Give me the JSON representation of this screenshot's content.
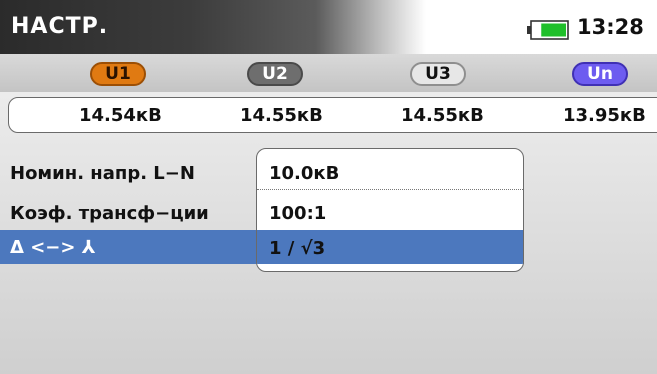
{
  "header": {
    "title": "НАСТР.",
    "time": "13:28",
    "battery_level": 0.75
  },
  "channels": [
    {
      "label": "U1",
      "color": "#e07a12"
    },
    {
      "label": "U2",
      "color": "#6e6e6e"
    },
    {
      "label": "U3",
      "color": "#e7e7e7"
    },
    {
      "label": "Un",
      "color": "#6d5cf0"
    }
  ],
  "readings": [
    "14.54кВ",
    "14.55кВ",
    "14.55кВ",
    "13.95кВ"
  ],
  "settings": [
    {
      "label": "Номин. напр. L−N",
      "value": "10.0кВ",
      "selected": false
    },
    {
      "label": "Коэф. трансф−ции",
      "value": "100:1",
      "selected": false
    },
    {
      "label": "Δ <−> ⅄",
      "value": "1 / √3",
      "selected": true
    }
  ],
  "colors": {
    "selection": "#4c78be",
    "battery": "#1fbf2a"
  }
}
